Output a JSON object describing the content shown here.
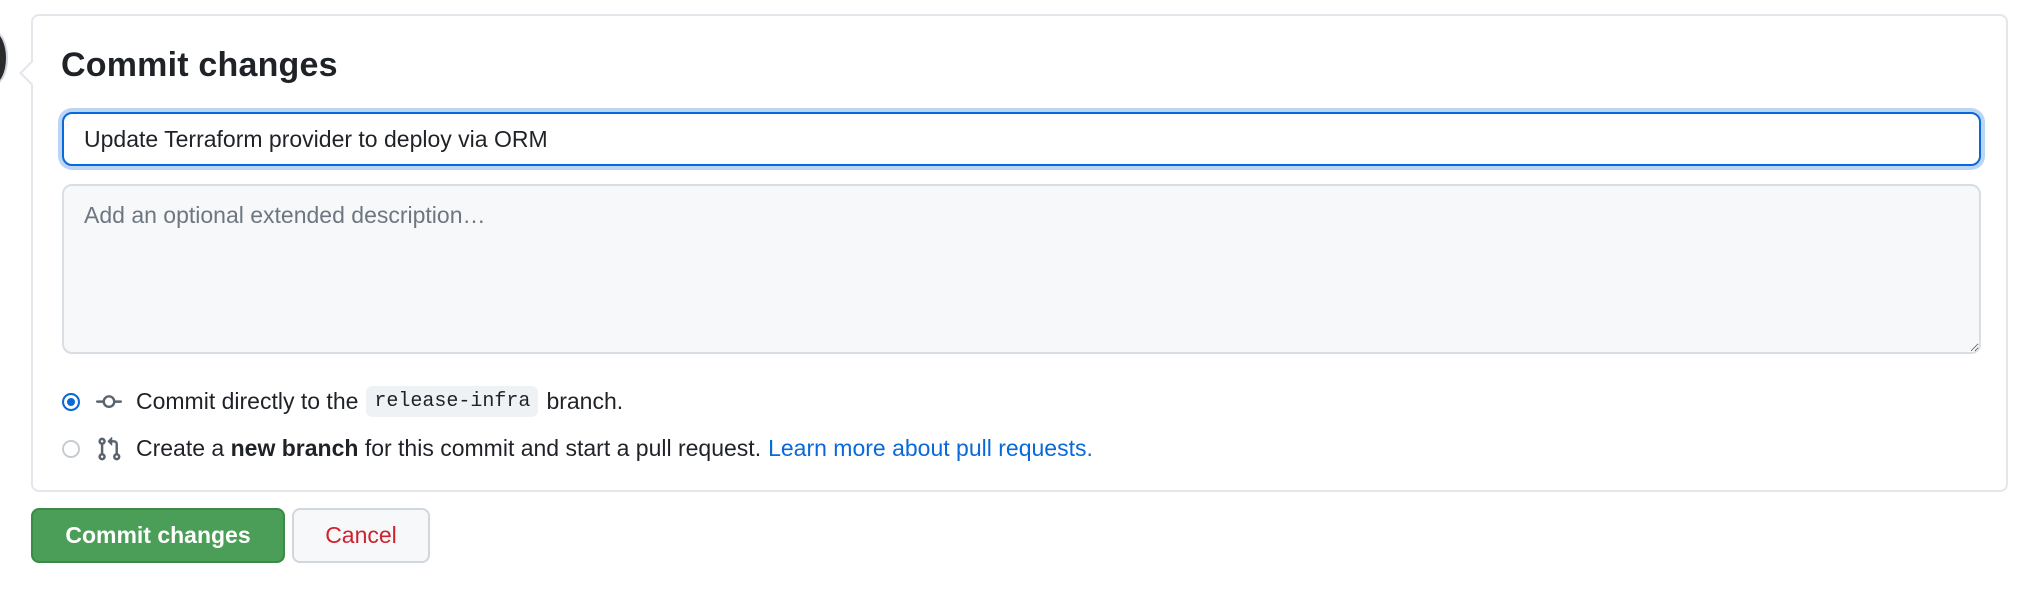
{
  "commit_form": {
    "title": "Commit changes",
    "summary_value": "Update Terraform provider to deploy via ORM",
    "description_placeholder": "Add an optional extended description…",
    "options": {
      "direct": {
        "selected": true,
        "prefix": "Commit directly to the",
        "branch_name": "release-infra",
        "suffix": "branch."
      },
      "new_branch": {
        "selected": false,
        "prefix": "Create a",
        "bold": "new branch",
        "suffix": "for this commit and start a pull request.",
        "link_text": "Learn more about pull requests."
      }
    }
  },
  "buttons": {
    "commit_label": "Commit changes",
    "cancel_label": "Cancel"
  },
  "colors": {
    "accent": "#0969da",
    "primary_button": "#4a9e57",
    "danger_text": "#cf222e",
    "link": "#0969da"
  },
  "icons": {
    "direct_commit": "git-commit-icon",
    "new_branch": "git-pull-request-icon"
  }
}
